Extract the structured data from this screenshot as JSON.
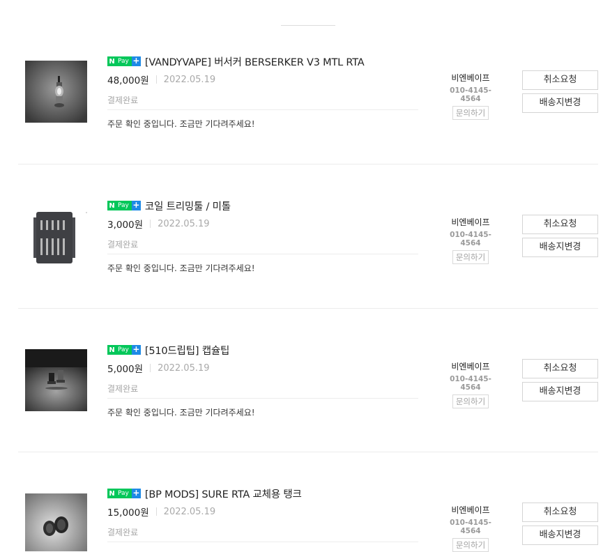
{
  "orders": [
    {
      "npay": {
        "n": "N",
        "pay": "Pay",
        "plus": "+"
      },
      "title": "[VANDYVAPE] 버서커 BERSERKER V3 MTL RTA",
      "price": "48,000원",
      "date": "2022.05.19",
      "status": "결제완료",
      "message": "주문 확인 중입니다. 조금만 기다려주세요!",
      "seller": {
        "name": "비엔베이프",
        "phone": "010-4145-4564",
        "ask_label": "문의하기"
      },
      "actions": {
        "cancel": "취소요청",
        "change_address": "배송지변경"
      }
    },
    {
      "npay": {
        "n": "N",
        "pay": "Pay",
        "plus": "+"
      },
      "title": "코일 트리밍툴 / 미톨",
      "price": "3,000원",
      "date": "2022.05.19",
      "status": "결제완료",
      "message": "주문 확인 중입니다. 조금만 기다려주세요!",
      "seller": {
        "name": "비엔베이프",
        "phone": "010-4145-4564",
        "ask_label": "문의하기"
      },
      "actions": {
        "cancel": "취소요청",
        "change_address": "배송지변경"
      }
    },
    {
      "npay": {
        "n": "N",
        "pay": "Pay",
        "plus": "+"
      },
      "title": "[510드립팁] 캡슐팁",
      "price": "5,000원",
      "date": "2022.05.19",
      "status": "결제완료",
      "message": "주문 확인 중입니다. 조금만 기다려주세요!",
      "seller": {
        "name": "비엔베이프",
        "phone": "010-4145-4564",
        "ask_label": "문의하기"
      },
      "actions": {
        "cancel": "취소요청",
        "change_address": "배송지변경"
      }
    },
    {
      "npay": {
        "n": "N",
        "pay": "Pay",
        "plus": "+"
      },
      "title": "[BP MODS] SURE RTA 교체용 탱크",
      "price": "15,000원",
      "date": "2022.05.19",
      "status": "결제완료",
      "message": "",
      "seller": {
        "name": "비엔베이프",
        "phone": "010-4145-4564",
        "ask_label": "문의하기"
      },
      "actions": {
        "cancel": "취소요청",
        "change_address": "배송지변경"
      }
    }
  ],
  "colors": {
    "npay_green": "#03c75a",
    "npay_plus_blue": "#1e8ae6",
    "muted_text": "#a6a6a6",
    "border": "#d4d4d4"
  }
}
